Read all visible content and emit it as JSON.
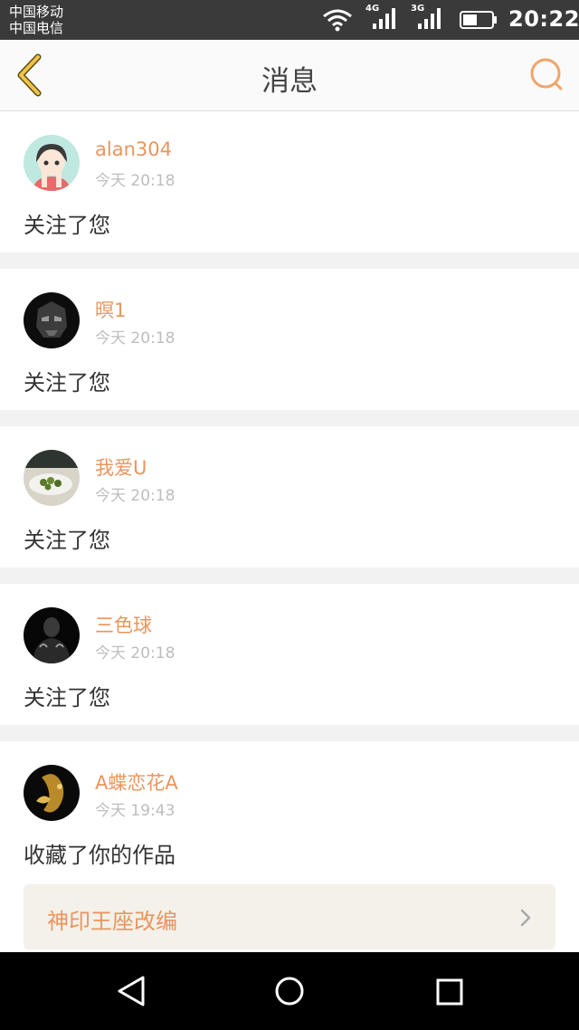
{
  "status_bar": {
    "carrier_1": "中国移动",
    "carrier_2": "中国电信",
    "network_1": "4G",
    "network_2": "3G",
    "time": "20:22"
  },
  "header": {
    "title": "消息",
    "back_icon": "chevron-left-icon",
    "search_icon": "search-icon"
  },
  "messages": [
    {
      "username": "alan304",
      "time": "今天 20:18",
      "action": "关注了您",
      "avatar": "anime-girl-avatar"
    },
    {
      "username": "暝1",
      "time": "今天 20:18",
      "action": "关注了您",
      "avatar": "dark-mask-avatar"
    },
    {
      "username": "我爱U",
      "time": "今天 20:18",
      "action": "关注了您",
      "avatar": "food-photo-avatar"
    },
    {
      "username": "三色球",
      "time": "今天 20:18",
      "action": "关注了您",
      "avatar": "dark-figure-avatar"
    },
    {
      "username": "A蝶恋花A",
      "time": "今天 19:43",
      "action": "收藏了你的作品",
      "avatar": "gold-figure-avatar",
      "work_title": "神印王座改编"
    }
  ],
  "colors": {
    "accent": "#e9955e",
    "back_icon": "#f0c34a",
    "background": "#f2f2f2"
  }
}
